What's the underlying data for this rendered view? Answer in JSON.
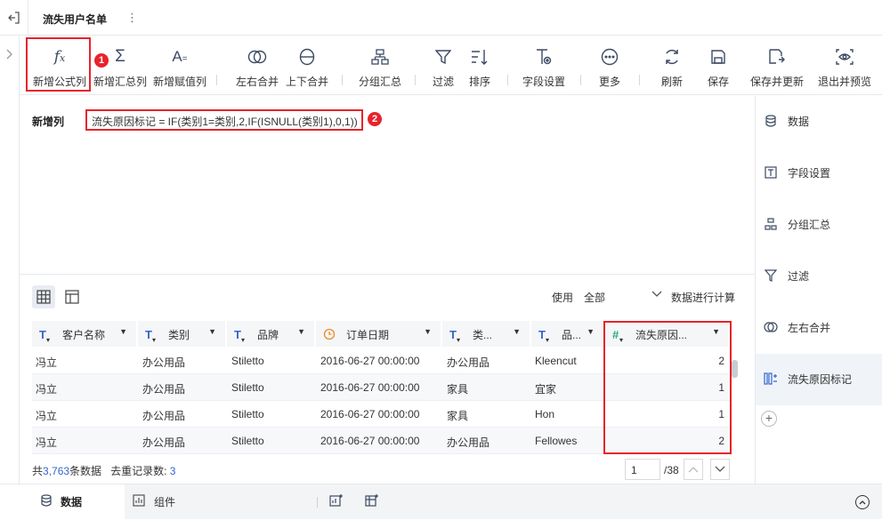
{
  "header": {
    "title": "流失用户名单"
  },
  "toolbar": {
    "items": [
      {
        "label": "新增公式列",
        "icon": "fx-icon"
      },
      {
        "label": "新增汇总列",
        "icon": "sigma-icon"
      },
      {
        "label": "新增赋值列",
        "icon": "assign-icon"
      },
      {
        "label": "左右合并",
        "icon": "join-lr-icon"
      },
      {
        "label": "上下合并",
        "icon": "join-ud-icon"
      },
      {
        "label": "分组汇总",
        "icon": "group-icon"
      },
      {
        "label": "过滤",
        "icon": "filter-icon"
      },
      {
        "label": "排序",
        "icon": "sort-icon"
      },
      {
        "label": "字段设置",
        "icon": "field-settings-icon"
      },
      {
        "label": "更多",
        "icon": "more-icon"
      },
      {
        "label": "刷新",
        "icon": "refresh-icon"
      },
      {
        "label": "保存",
        "icon": "save-icon"
      },
      {
        "label": "保存并更新",
        "icon": "save-update-icon"
      },
      {
        "label": "退出并预览",
        "icon": "preview-icon"
      }
    ]
  },
  "badges": {
    "one": "1",
    "two": "2"
  },
  "formula": {
    "label": "新增列",
    "expression": "流失原因标记 = IF(类别1=类别,2,IF(ISNULL(类别1),0,1))"
  },
  "right_panel": {
    "items": [
      {
        "label": "数据"
      },
      {
        "label": "字段设置"
      },
      {
        "label": "分组汇总"
      },
      {
        "label": "过滤"
      },
      {
        "label": "左右合并"
      },
      {
        "label": "流失原因标记"
      }
    ]
  },
  "calc": {
    "prefix": "使用",
    "value": "全部",
    "suffix": "数据进行计算"
  },
  "table": {
    "columns": [
      "客户名称",
      "类别",
      "品牌",
      "订单日期",
      "类...",
      "品...",
      "流失原因..."
    ],
    "rows": [
      [
        "冯立",
        "办公用品",
        "Stiletto",
        "2016-06-27 00:00:00",
        "办公用品",
        "Kleencut",
        "2"
      ],
      [
        "冯立",
        "办公用品",
        "Stiletto",
        "2016-06-27 00:00:00",
        "家具",
        "宜家",
        "1"
      ],
      [
        "冯立",
        "办公用品",
        "Stiletto",
        "2016-06-27 00:00:00",
        "家具",
        "Hon",
        "1"
      ],
      [
        "冯立",
        "办公用品",
        "Stiletto",
        "2016-06-27 00:00:00",
        "办公用品",
        "Fellowes",
        "2"
      ]
    ]
  },
  "footer": {
    "total_prefix": "共",
    "total": "3,763",
    "total_suffix": "条数据",
    "dedupe_label": "去重记录数:",
    "dedupe": "3",
    "page": "1",
    "page_total": "/38"
  },
  "bottom": {
    "tab_data": "数据",
    "tab_component": "组件"
  },
  "colors": {
    "accent": "#3366cc",
    "highlight": "#e8232b"
  }
}
